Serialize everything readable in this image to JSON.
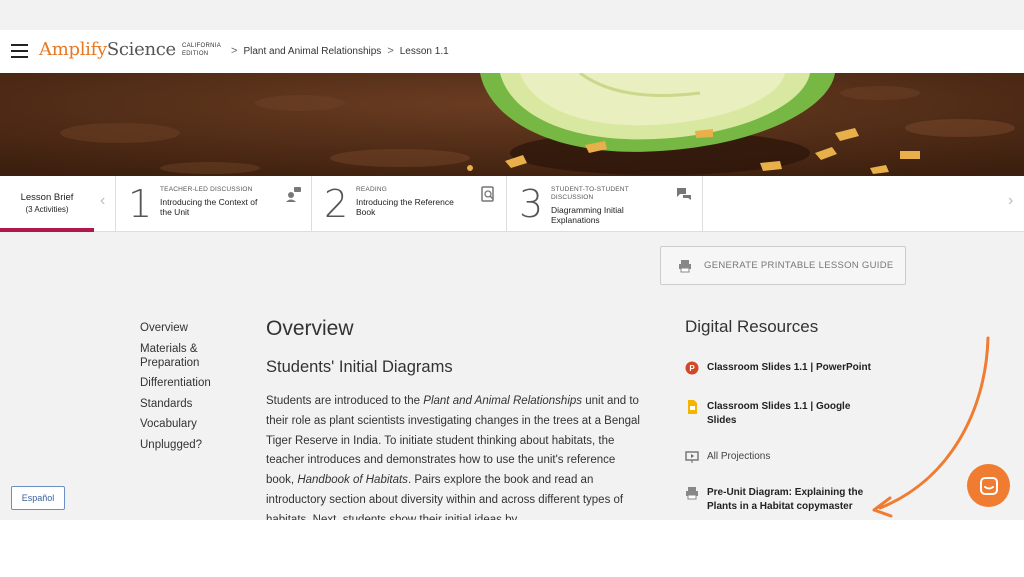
{
  "header": {
    "logo_brand": "Amplify",
    "logo_product": "Science",
    "edition_line1": "CALIFORNIA",
    "edition_line2": "EDITION",
    "breadcrumbs": [
      "Plant and Animal Relationships",
      "Lesson 1.1"
    ],
    "breadcrumb_separator": ">"
  },
  "activity_bar": {
    "brief_title": "Lesson Brief",
    "brief_subtitle": "(3 Activities)",
    "activities": [
      {
        "number": "1",
        "category": "TEACHER-LED DISCUSSION",
        "title": "Introducing the Context of the Unit",
        "icon": "discussion-icon"
      },
      {
        "number": "2",
        "category": "READING",
        "title": "Introducing the Reference Book",
        "icon": "book-search-icon"
      },
      {
        "number": "3",
        "category": "STUDENT-TO-STUDENT DISCUSSION",
        "title": "Diagramming Initial Explanations",
        "icon": "chat-bubbles-icon"
      }
    ]
  },
  "generate_button": {
    "label": "GENERATE PRINTABLE LESSON GUIDE"
  },
  "left_nav": [
    "Overview",
    "Materials & Preparation",
    "Differentiation",
    "Standards",
    "Vocabulary",
    "Unplugged?"
  ],
  "main": {
    "heading": "Overview",
    "subheading": "Students' Initial Diagrams",
    "p_part1": "Students are introduced to the ",
    "p_italic1": "Plant and Animal Relationships",
    "p_part2": " unit and to their role as plant scientists investigating changes in the trees at a Bengal Tiger Reserve in India. To initiate student thinking about habitats, the teacher introduces and demonstrates how to use the unit's reference book, ",
    "p_italic2": "Handbook of Habitats",
    "p_part3": ". Pairs explore the book and read an introductory section about diversity within and across different types of habitats. Next, students show their initial ideas by"
  },
  "resources": {
    "heading": "Digital Resources",
    "items": [
      {
        "label": "Classroom Slides 1.1 | PowerPoint",
        "icon": "powerpoint-icon"
      },
      {
        "label": "Classroom Slides 1.1 | Google Slides",
        "icon": "google-slides-icon"
      },
      {
        "label": "All Projections",
        "icon": "projector-icon"
      },
      {
        "label": "Pre-Unit Diagram: Explaining the Plants in a Habitat copymaster",
        "icon": "print-icon"
      }
    ]
  },
  "language_button": "Español",
  "colors": {
    "brand_orange": "#e87722",
    "active_tab": "#b0174a",
    "chat_button": "#f07c32",
    "arrow_annotation": "#f07c32"
  }
}
